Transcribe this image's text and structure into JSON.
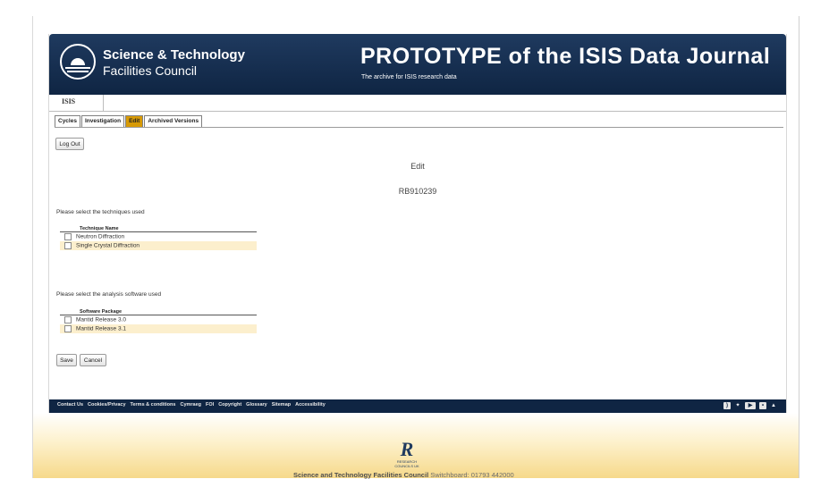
{
  "header": {
    "org_line1": "Science & Technology",
    "org_line2": "Facilities Council",
    "title": "PROTOTYPE of the ISIS Data Journal",
    "subtitle": "The archive for ISIS research data"
  },
  "breadcrumb": {
    "label": "ISIS"
  },
  "tabs": [
    {
      "label": "Cycles",
      "active": false
    },
    {
      "label": "Investigation",
      "active": false
    },
    {
      "label": "Edit",
      "active": true
    },
    {
      "label": "Archived Versions",
      "active": false
    }
  ],
  "buttons": {
    "logout": "Log Out",
    "save": "Save",
    "cancel": "Cancel"
  },
  "main": {
    "heading": "Edit",
    "investigation_id": "RB910239"
  },
  "techniques": {
    "prompt": "Please select the techniques used",
    "column": "Technique Name",
    "items": [
      "Neutron Diffraction",
      "Single Crystal Diffraction"
    ]
  },
  "software": {
    "prompt": "Please select the analysis software used",
    "column": "Software Package",
    "items": [
      "Mantid Release 3.0",
      "Mantid Release 3.1"
    ]
  },
  "footer": {
    "links": [
      "Contact Us",
      "Cookies/Privacy",
      "Terms & conditions",
      "Cymraeg",
      "FOI",
      "Copyright",
      "Glossary",
      "Sitemap",
      "Accessibility"
    ],
    "social_icons": [
      "rss-icon",
      "twitter-icon",
      "youtube-icon",
      "flickr-icon",
      "print-icon"
    ]
  },
  "bottom": {
    "logo_text_1": "RESEARCH",
    "logo_text_2": "COUNCILS UK",
    "org": "Science and Technology Facilities Council",
    "switchboard": "Switchboard: 01793 442000"
  },
  "colors": {
    "header_navy": "#1f3a5f",
    "active_tab": "#d79a06",
    "row_highlight": "#fcefcd"
  }
}
